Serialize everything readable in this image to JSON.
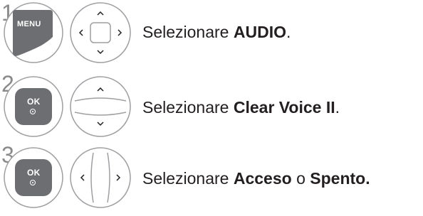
{
  "steps": [
    {
      "number": "1",
      "button_label": "MENU",
      "button_icon": "menu-button-icon",
      "pad_icon": "four-way-navigation-pad-icon",
      "text_prefix": "Selezionare ",
      "text_bold_1": "AUDIO",
      "text_middle": "",
      "text_bold_2": "",
      "text_suffix": "."
    },
    {
      "number": "2",
      "button_label": "OK",
      "button_icon": "ok-button-icon",
      "pad_icon": "up-down-navigation-icon",
      "text_prefix": "Selezionare ",
      "text_bold_1": "Clear Voice II",
      "text_middle": "",
      "text_bold_2": "",
      "text_suffix": "."
    },
    {
      "number": "3",
      "button_label": "OK",
      "button_icon": "ok-button-icon",
      "pad_icon": "left-right-navigation-icon",
      "text_prefix": "Selezionare ",
      "text_bold_1": "Acceso",
      "text_middle": " o ",
      "text_bold_2": "Spento.",
      "text_suffix": ""
    }
  ],
  "colors": {
    "button_fill": "#6d6e71",
    "outline": "#9d9fa2",
    "text": "#231f20"
  }
}
